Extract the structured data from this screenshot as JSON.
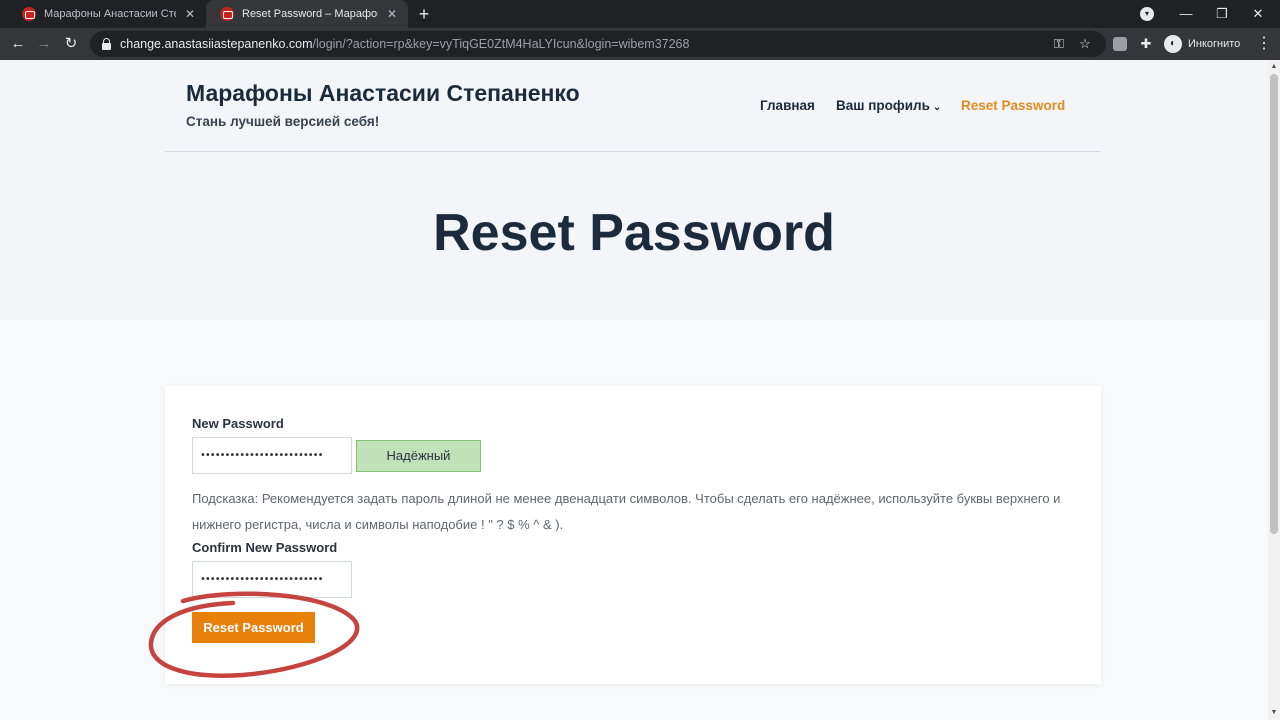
{
  "browser": {
    "tabs": [
      {
        "title": "Марафоны Анастасии Степане",
        "active": false
      },
      {
        "title": "Reset Password – Марафоны Ан",
        "active": true
      }
    ],
    "new_tab": "+",
    "url_host": "change.anastasiiastepanenko.com",
    "url_path": "/login/?action=rp&key=vyTiqGE0ZtM4HaLYIcun&login=wibem37268",
    "incognito_label": "Инкогнито"
  },
  "site": {
    "title": "Марафоны Анастасии Степаненко",
    "tagline": "Стань лучшей версией себя!",
    "nav": [
      {
        "label": "Главная"
      },
      {
        "label": "Ваш профиль"
      },
      {
        "label": "Reset Password"
      }
    ]
  },
  "page": {
    "heading": "Reset Password"
  },
  "form": {
    "new_password_label": "New Password",
    "new_password_value": "•••••••••••••••••••••••••",
    "strength_label": "Надёжный",
    "hint": "Подсказка: Рекомендуется задать пароль длиной не менее двенадцати символов. Чтобы сделать его надёжнее, используйте буквы верхнего и нижнего регистра, числа и символы наподобие ! \" ? $ % ^ & ).",
    "confirm_label": "Confirm New Password",
    "confirm_value": "•••••••••••••••••••••••••",
    "submit_label": "Reset Password"
  },
  "colors": {
    "accent": "#e8800c",
    "heading": "#1b2b3d",
    "strength_bg": "#c1e1b9",
    "annotation": "#c0302a"
  }
}
